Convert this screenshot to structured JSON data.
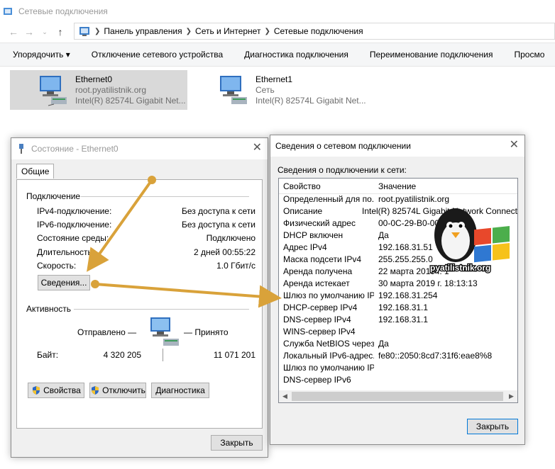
{
  "window": {
    "title": "Сетевые подключения"
  },
  "address": {
    "crumbs": [
      "Панель управления",
      "Сеть и Интернет",
      "Сетевые подключения"
    ]
  },
  "toolbar": {
    "organize": "Упорядочить ▾",
    "disable": "Отключение сетевого устройства",
    "diagnose": "Диагностика подключения",
    "rename": "Переименование подключения",
    "view": "Просмо"
  },
  "adapters": [
    {
      "name": "Ethernet0",
      "network": "root.pyatilistnik.org",
      "device": "Intel(R) 82574L Gigabit Net..."
    },
    {
      "name": "Ethernet1",
      "network": "Сеть",
      "device": "Intel(R) 82574L Gigabit Net..."
    }
  ],
  "status_dialog": {
    "title": "Состояние - Ethernet0",
    "tab": "Общие",
    "connection_label": "Подключение",
    "ipv4_label": "IPv4-подключение:",
    "ipv4_value": "Без доступа к сети",
    "ipv6_label": "IPv6-подключение:",
    "ipv6_value": "Без доступа к сети",
    "media_label": "Состояние среды:",
    "media_value": "Подключено",
    "duration_label": "Длительность:",
    "duration_value": "2 дней 00:55:22",
    "speed_label": "Скорость:",
    "speed_value": "1.0 Гбит/с",
    "details_button": "Сведения...",
    "activity_label": "Активность",
    "sent_label": "Отправлено —",
    "received_label": "— Принято",
    "bytes_label": "Байт:",
    "bytes_sent": "4 320 205",
    "bytes_received": "11 071 201",
    "properties_button": "Свойства",
    "disable_button": "Отключить",
    "diagnose_button": "Диагностика",
    "close_button": "Закрыть"
  },
  "details_dialog": {
    "title": "Сведения о сетевом подключении",
    "caption": "Сведения о подключении к сети:",
    "col_property": "Свойство",
    "col_value": "Значение",
    "rows": [
      {
        "property": "Определенный для по...",
        "value": "root.pyatilistnik.org"
      },
      {
        "property": "Описание",
        "value": "Intel(R) 82574L Gigabit Network Connect"
      },
      {
        "property": "Физический адрес",
        "value": "00-0C-29-B0-00-10"
      },
      {
        "property": "DHCP включен",
        "value": "Да"
      },
      {
        "property": "Адрес IPv4",
        "value": "192.168.31.51"
      },
      {
        "property": "Маска подсети IPv4",
        "value": "255.255.255.0"
      },
      {
        "property": "Аренда получена",
        "value": "22 марта 2019 г. 1"
      },
      {
        "property": "Аренда истекает",
        "value": "30 марта 2019 г. 18:13:13"
      },
      {
        "property": "Шлюз по умолчанию IP...",
        "value": "192.168.31.254"
      },
      {
        "property": "DHCP-сервер IPv4",
        "value": "192.168.31.1"
      },
      {
        "property": "DNS-сервер IPv4",
        "value": "192.168.31.1"
      },
      {
        "property": "WINS-сервер IPv4",
        "value": ""
      },
      {
        "property": "Служба NetBIOS черeз...",
        "value": "Да"
      },
      {
        "property": "Локальный IPv6-адрес...",
        "value": "fe80::2050:8cd7:31f6:eae8%8"
      },
      {
        "property": "Шлюз по умолчанию IP...",
        "value": ""
      },
      {
        "property": "DNS-сервер IPv6",
        "value": ""
      }
    ],
    "close_button": "Закрыть"
  },
  "logo": {
    "text": "pyatilistnik.org"
  },
  "colors": {
    "arrow": "#d9a23a",
    "selected_bg": "#d9d9d9",
    "dialog_bg": "#f0f0f0"
  }
}
